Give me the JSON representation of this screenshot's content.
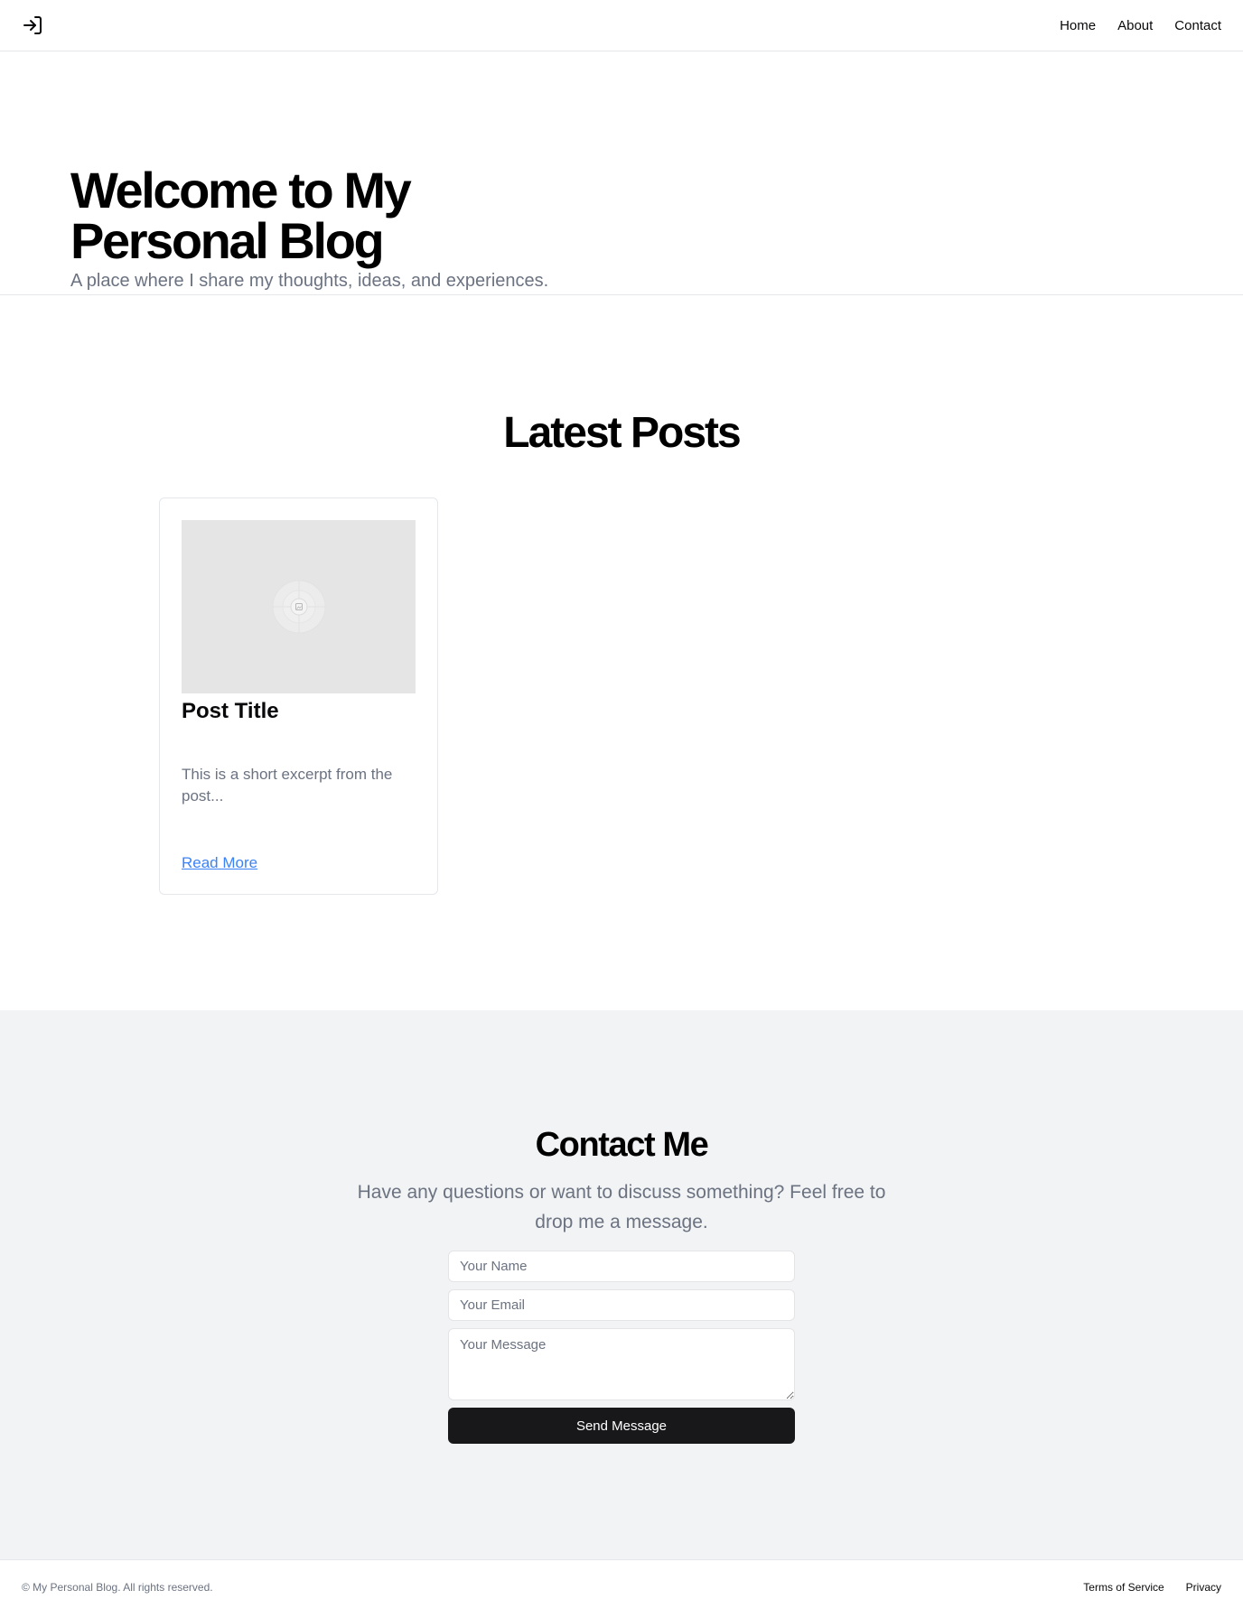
{
  "header": {
    "logo_icon": "log-in-icon",
    "nav": [
      {
        "label": "Home"
      },
      {
        "label": "About"
      },
      {
        "label": "Contact"
      }
    ]
  },
  "hero": {
    "title": "Welcome to My Personal Blog",
    "subtitle": "A place where I share my thoughts, ideas, and experiences."
  },
  "posts": {
    "title": "Latest Posts",
    "items": [
      {
        "image_icon": "image-placeholder-icon",
        "title": "Post Title",
        "excerpt": "This is a short excerpt from the post...",
        "link_label": "Read More"
      }
    ]
  },
  "contact": {
    "title": "Contact Me",
    "subtitle": "Have any questions or want to discuss something? Feel free to drop me a message.",
    "name_placeholder": "Your Name",
    "email_placeholder": "Your Email",
    "message_placeholder": "Your Message",
    "submit_label": "Send Message"
  },
  "footer": {
    "copyright": "© My Personal Blog. All rights reserved.",
    "links": [
      {
        "label": "Terms of Service"
      },
      {
        "label": "Privacy"
      }
    ]
  },
  "colors": {
    "link": "#3b82f6",
    "button_bg": "#18181b",
    "muted_text": "#6b7280",
    "contact_bg": "#f2f3f5"
  }
}
